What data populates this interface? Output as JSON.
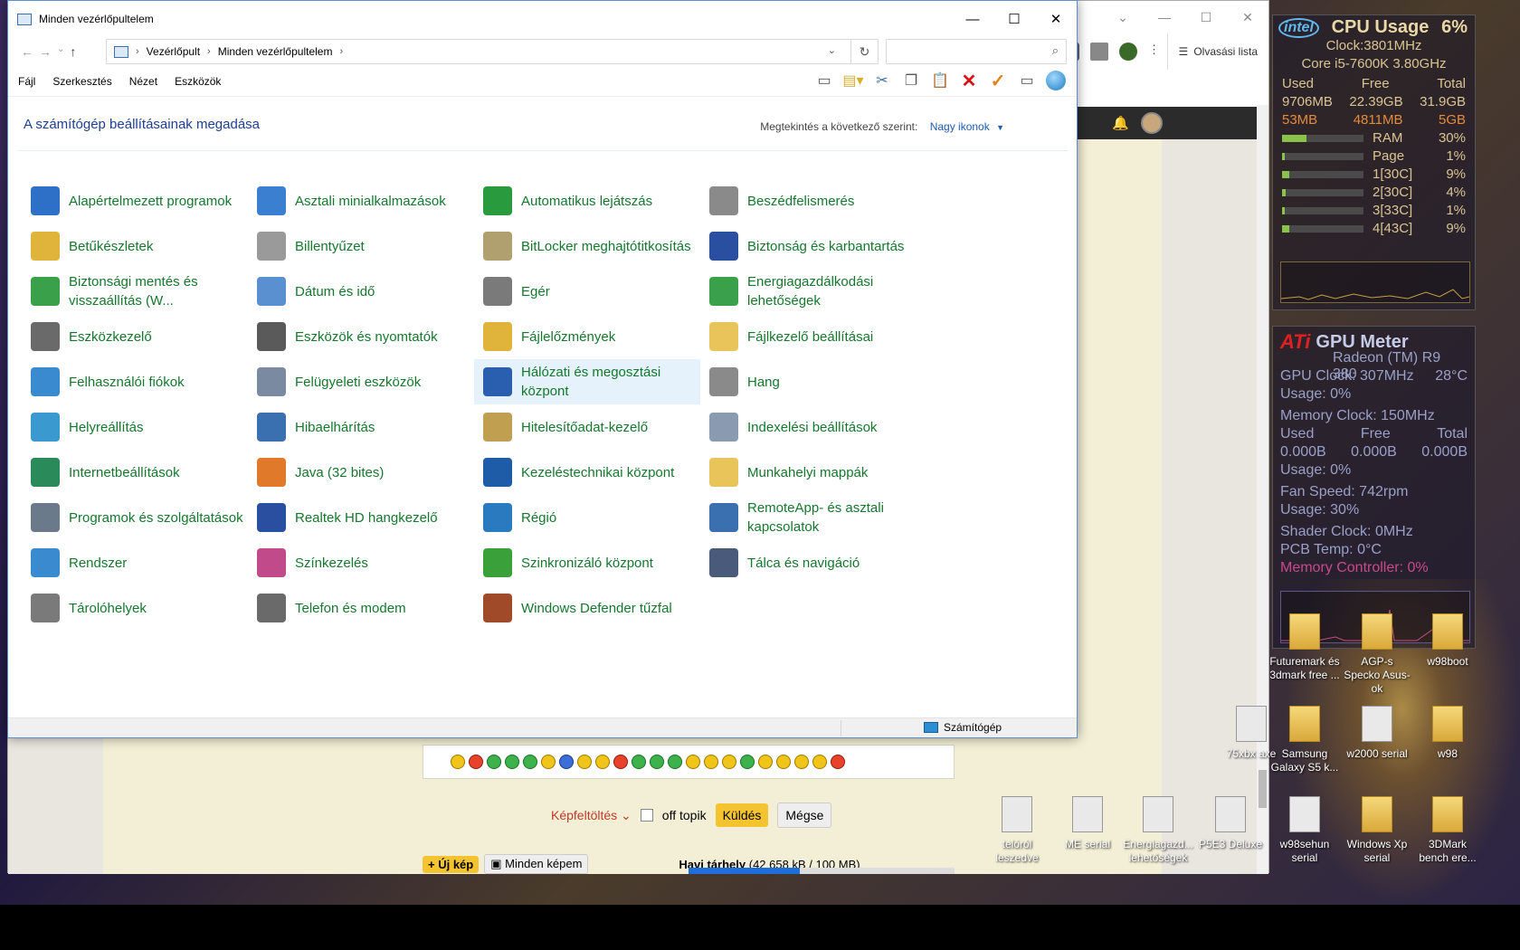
{
  "window": {
    "title": "Minden vezérlőpultelem",
    "minimize": "—",
    "maximize": "☐",
    "close": "✕"
  },
  "address": {
    "crumbs": [
      "Vezérlőpult",
      "Minden vezérlőpultelem"
    ],
    "search_placeholder": ""
  },
  "menu": [
    "Fájl",
    "Szerkesztés",
    "Nézet",
    "Eszközök"
  ],
  "heading": {
    "title": "A számítógép beállításainak megadása",
    "view_by_label": "Megtekintés a következő szerint:",
    "view_by_value": "Nagy ikonok"
  },
  "items": [
    {
      "label": "Alapértelmezett programok",
      "icon": "default-programs-icon",
      "color": "#2e6fc7"
    },
    {
      "label": "Asztali minialkalmazások",
      "icon": "gadgets-icon",
      "color": "#3a7fd0"
    },
    {
      "label": "Automatikus lejátszás",
      "icon": "autoplay-icon",
      "color": "#2a9a3e"
    },
    {
      "label": "Beszédfelismerés",
      "icon": "microphone-icon",
      "color": "#8a8a8a"
    },
    {
      "label": "Betűkészletek",
      "icon": "fonts-icon",
      "color": "#e0b43a"
    },
    {
      "label": "Billentyűzet",
      "icon": "keyboard-icon",
      "color": "#9a9a9a"
    },
    {
      "label": "BitLocker meghajtótitkosítás",
      "icon": "bitlocker-icon",
      "color": "#b0a070"
    },
    {
      "label": "Biztonság és karbantartás",
      "icon": "security-flag-icon",
      "color": "#2a4fa0"
    },
    {
      "label": "Biztonsági mentés és visszaállítás (W...",
      "icon": "backup-icon",
      "color": "#3aa04a"
    },
    {
      "label": "Dátum és idő",
      "icon": "datetime-icon",
      "color": "#5a8fd0"
    },
    {
      "label": "Egér",
      "icon": "mouse-icon",
      "color": "#7a7a7a"
    },
    {
      "label": "Energiagazdálkodási lehetőségek",
      "icon": "power-options-icon",
      "color": "#3aa04a"
    },
    {
      "label": "Eszközkezelő",
      "icon": "device-manager-icon",
      "color": "#6a6a6a"
    },
    {
      "label": "Eszközök és nyomtatók",
      "icon": "printer-icon",
      "color": "#5a5a5a"
    },
    {
      "label": "Fájlelőzmények",
      "icon": "file-history-icon",
      "color": "#e0b43a"
    },
    {
      "label": "Fájlkezelő beállításai",
      "icon": "folder-options-icon",
      "color": "#e8c45a"
    },
    {
      "label": "Felhasználói fiókok",
      "icon": "user-accounts-icon",
      "color": "#3a8ad0"
    },
    {
      "label": "Felügyeleti eszközök",
      "icon": "admin-tools-icon",
      "color": "#7a8aa0"
    },
    {
      "label": "Hálózati és megosztási központ",
      "icon": "network-icon",
      "color": "#2a5fb0"
    },
    {
      "label": "Hang",
      "icon": "sound-icon",
      "color": "#8a8a8a"
    },
    {
      "label": "Helyreállítás",
      "icon": "recovery-icon",
      "color": "#3a9ad0"
    },
    {
      "label": "Hibaelhárítás",
      "icon": "troubleshooting-icon",
      "color": "#3a6fb0"
    },
    {
      "label": "Hitelesítőadat-kezelő",
      "icon": "credential-icon",
      "color": "#c0a050"
    },
    {
      "label": "Indexelési beállítások",
      "icon": "indexing-icon",
      "color": "#8a9ab0"
    },
    {
      "label": "Internetbeállítások",
      "icon": "internet-options-icon",
      "color": "#2a8a5a"
    },
    {
      "label": "Java (32 bites)",
      "icon": "java-icon",
      "color": "#e07a2a"
    },
    {
      "label": "Kezeléstechnikai központ",
      "icon": "ease-of-access-icon",
      "color": "#1e5ca8"
    },
    {
      "label": "Munkahelyi mappák",
      "icon": "work-folders-icon",
      "color": "#e8c45a"
    },
    {
      "label": "Programok és szolgáltatások",
      "icon": "programs-icon",
      "color": "#6a7a8a"
    },
    {
      "label": "Realtek HD hangkezelő",
      "icon": "realtek-icon",
      "color": "#2a4fa0"
    },
    {
      "label": "Régió",
      "icon": "region-icon",
      "color": "#2a7ac0"
    },
    {
      "label": "RemoteApp- és asztali kapcsolatok",
      "icon": "remoteapp-icon",
      "color": "#3a6fb0"
    },
    {
      "label": "Rendszer",
      "icon": "system-icon",
      "color": "#3a8ad0"
    },
    {
      "label": "Színkezelés",
      "icon": "color-management-icon",
      "color": "#c04a8a"
    },
    {
      "label": "Szinkronizáló központ",
      "icon": "sync-center-icon",
      "color": "#3aa03a"
    },
    {
      "label": "Tálca és navigáció",
      "icon": "taskbar-icon",
      "color": "#4a5a7a"
    },
    {
      "label": "Tárolóhelyek",
      "icon": "storage-spaces-icon",
      "color": "#7a7a7a"
    },
    {
      "label": "Telefon és modem",
      "icon": "phone-modem-icon",
      "color": "#6a6a6a"
    },
    {
      "label": "Windows Defender tűzfal",
      "icon": "firewall-icon",
      "color": "#a04a2a"
    }
  ],
  "hovered_item": "Hálózati és megosztási központ",
  "status": {
    "computer": "Számítógép"
  },
  "browser": {
    "reading_list": "Olvasási lista",
    "image_upload": "Képfeltöltés",
    "off_topic": "off topik",
    "send": "Küldés",
    "cancel": "Mégse",
    "new_image": "Új kép",
    "all_images": "Minden képem",
    "quota_label": "Havi tárhely",
    "quota_value": "(42 658 kB / 100 MB)",
    "quota_fraction": 0.42
  },
  "cpu_gadget": {
    "title": "CPU Usage",
    "usage": "6%",
    "clock": "Clock:3801MHz",
    "model": "Core i5-7600K 3.80GHz",
    "headers": [
      "Used",
      "Free",
      "Total"
    ],
    "row1": [
      "9706MB",
      "22.39GB",
      "31.9GB"
    ],
    "row2": [
      "53MB",
      "4811MB",
      "5GB"
    ],
    "bars": [
      {
        "label": "RAM",
        "value": "30%",
        "fill": 0.3
      },
      {
        "label": "Page",
        "value": "1%",
        "fill": 0.01
      },
      {
        "label": "1[30C]",
        "value": "9%",
        "fill": 0.09
      },
      {
        "label": "2[30C]",
        "value": "4%",
        "fill": 0.04
      },
      {
        "label": "3[33C]",
        "value": "1%",
        "fill": 0.01
      },
      {
        "label": "4[43C]",
        "value": "9%",
        "fill": 0.09
      }
    ]
  },
  "gpu_gadget": {
    "title": "GPU Meter",
    "model": "Radeon (TM) R9 380",
    "gpu_clock": "GPU Clock: 307MHz",
    "temp": "28°C",
    "usage1": "Usage: 0%",
    "mem_clock": "Memory Clock: 150MHz",
    "headers": [
      "Used",
      "Free",
      "Total"
    ],
    "mem_row": [
      "0.000B",
      "0.000B",
      "0.000B"
    ],
    "usage2": "Usage: 0%",
    "fan": "Fan Speed: 742rpm",
    "usage3": "Usage: 30%",
    "shader": "Shader Clock: 0MHz",
    "pcb": "PCB Temp: 0°C",
    "mem_ctrl": "Memory Controller: 0%"
  },
  "desktop_icons": [
    {
      "label": "Futuremark és 3dmark free ..."
    },
    {
      "label": "AGP-s Specko Asus-ok"
    },
    {
      "label": "w98boot"
    },
    {
      "label": "75xbx axe"
    },
    {
      "label": "Samsung Galaxy S5 k..."
    },
    {
      "label": "w2000 serial"
    },
    {
      "label": "w98"
    },
    {
      "label": "telóról leszedve"
    },
    {
      "label": "ME serial"
    },
    {
      "label": "Energiagazd... lehetőségek"
    },
    {
      "label": "P5E3 Deluxe"
    },
    {
      "label": "w98sehun serial"
    },
    {
      "label": "Windows Xp serial"
    },
    {
      "label": "3DMark bench ere..."
    }
  ]
}
